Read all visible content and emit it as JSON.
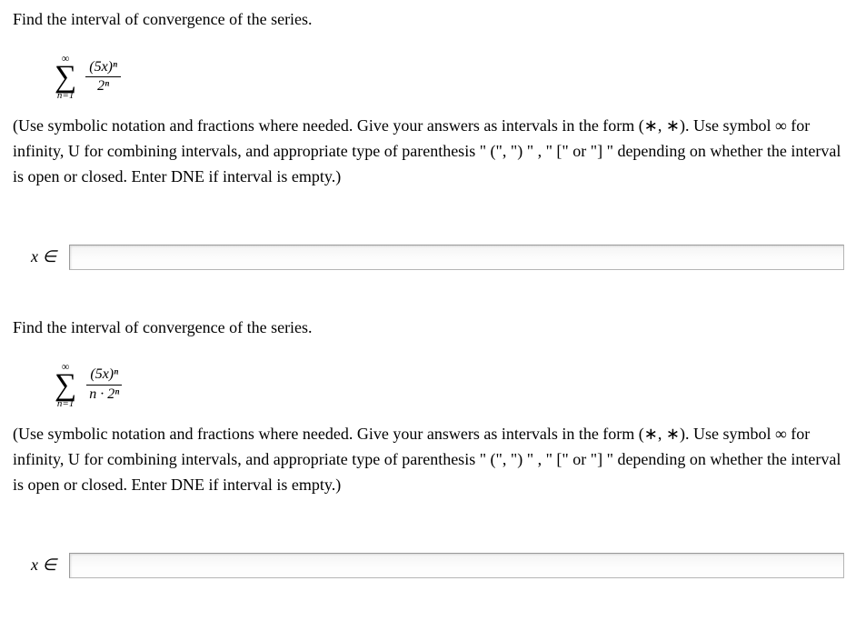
{
  "questions": [
    {
      "prompt": "Find the interval of convergence of the series.",
      "sigma_top": "∞",
      "sigma_glyph": "∑",
      "sigma_bottom": "n=1",
      "numerator": "(5x)ⁿ",
      "denominator": "2ⁿ",
      "instructions": "(Use symbolic notation and fractions where needed. Give your answers as intervals in the form (∗, ∗). Use symbol ∞ for infinity, U for combining intervals, and appropriate type of parenthesis \" (\", \") \" ,  \" [\" or \"] \" depending on whether the interval is open or closed. Enter DNE if interval is empty.)",
      "answer_label": "x ∈",
      "answer_value": ""
    },
    {
      "prompt": "Find the interval of convergence of the series.",
      "sigma_top": "∞",
      "sigma_glyph": "∑",
      "sigma_bottom": "n=1",
      "numerator": "(5x)ⁿ",
      "denominator": "n · 2ⁿ",
      "instructions": "(Use symbolic notation and fractions where needed. Give your answers as intervals in the form (∗, ∗). Use symbol ∞ for infinity, U for combining intervals, and appropriate type of parenthesis \" (\", \") \" ,  \" [\" or \"] \" depending on whether the interval is open or closed. Enter DNE if interval is empty.)",
      "answer_label": "x ∈",
      "answer_value": ""
    }
  ]
}
